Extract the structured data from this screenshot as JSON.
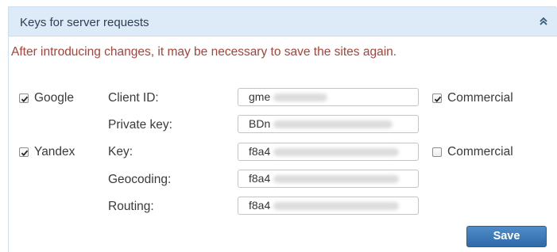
{
  "panel": {
    "title": "Keys for server requests",
    "collapse_icon": "double-chevron-up-icon"
  },
  "notice": "After introducing changes, it may be necessary to save the sites again.",
  "google": {
    "enabled_label": "Google",
    "enabled_checked": true,
    "client_id_label": "Client ID:",
    "client_id_value": "gme",
    "private_key_label": "Private key:",
    "private_key_value": "BDn",
    "commercial_label": "Commercial",
    "commercial_checked": true
  },
  "yandex": {
    "enabled_label": "Yandex",
    "enabled_checked": true,
    "key_label": "Key:",
    "key_value": "f8a4",
    "geocoding_label": "Geocoding:",
    "geocoding_value": "f8a4",
    "routing_label": "Routing:",
    "routing_value": "f8a4",
    "commercial_label": "Commercial",
    "commercial_checked": false
  },
  "actions": {
    "save_label": "Save"
  }
}
